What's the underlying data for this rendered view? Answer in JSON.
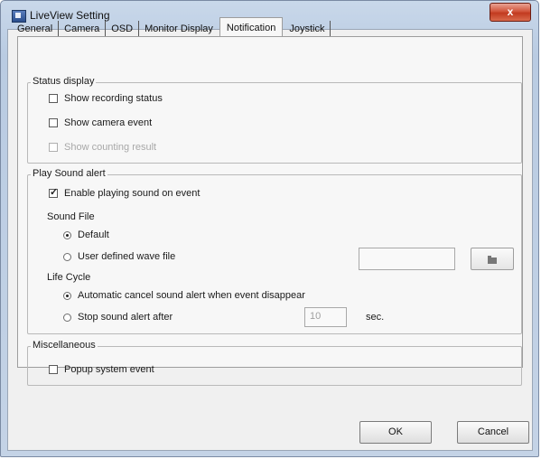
{
  "window": {
    "title": "LiveView Setting",
    "close_label": "x"
  },
  "tabs": [
    {
      "label": "General"
    },
    {
      "label": "Camera"
    },
    {
      "label": "OSD"
    },
    {
      "label": "Monitor Display"
    },
    {
      "label": "Notification"
    },
    {
      "label": "Joystick"
    }
  ],
  "status_display": {
    "title": "Status display",
    "show_recording_status": "Show recording status",
    "show_camera_event": "Show camera event",
    "show_counting_result": "Show counting result"
  },
  "play_sound": {
    "title": "Play Sound alert",
    "enable_label": "Enable playing sound on event",
    "sound_file_label": "Sound File",
    "default_label": "Default",
    "user_defined_label": "User defined wave file",
    "wave_file_value": "",
    "life_cycle_label": "Life Cycle",
    "auto_cancel_label": "Automatic cancel sound alert when event disappear",
    "stop_after_label": "Stop sound alert after",
    "stop_after_value": "10",
    "sec_label": "sec."
  },
  "misc": {
    "title": "Miscellaneous",
    "popup_label": "Popup system event"
  },
  "buttons": {
    "ok": "OK",
    "cancel": "Cancel"
  }
}
